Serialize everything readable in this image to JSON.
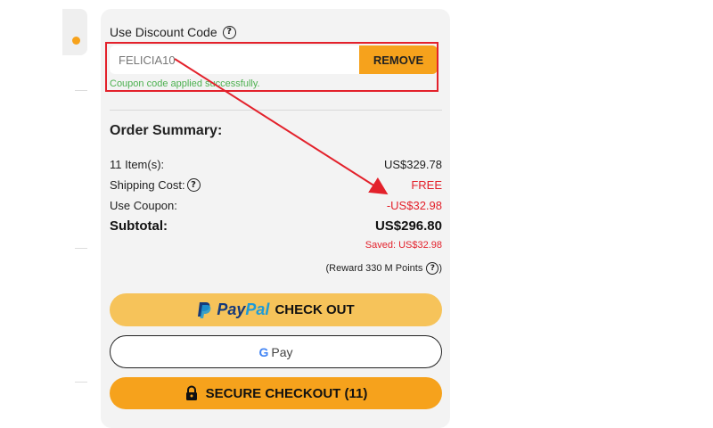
{
  "discount": {
    "heading": "Use Discount Code",
    "input_value": "FELICIA10",
    "remove_label": "REMOVE",
    "success_message": "Coupon code applied successfully."
  },
  "summary": {
    "title": "Order Summary:",
    "items_label": "11 Item(s):",
    "items_value": "US$329.78",
    "shipping_label": "Shipping Cost:",
    "shipping_value": "FREE",
    "coupon_label": "Use Coupon:",
    "coupon_value": "-US$32.98",
    "subtotal_label": "Subtotal:",
    "subtotal_value": "US$296.80",
    "saved": "Saved: US$32.98",
    "reward": "(Reward 330 M Points",
    "reward_close": ")"
  },
  "buttons": {
    "paypal_pay": "Pay",
    "paypal_pal": "Pal",
    "paypal_checkout": "CHECK OUT",
    "gpay_g": "G",
    "gpay_pay": "Pay",
    "secure_checkout": "SECURE CHECKOUT (11)"
  },
  "icons": {
    "help": "question-circle-icon",
    "lock": "lock-icon",
    "paypal": "paypal-logo",
    "google": "google-g-logo"
  },
  "colors": {
    "accent": "#f6a21c",
    "paypal_button": "#f6c35a",
    "success": "#4cb04f",
    "price_red": "#e3212b",
    "annotation_red": "#e3212b"
  }
}
